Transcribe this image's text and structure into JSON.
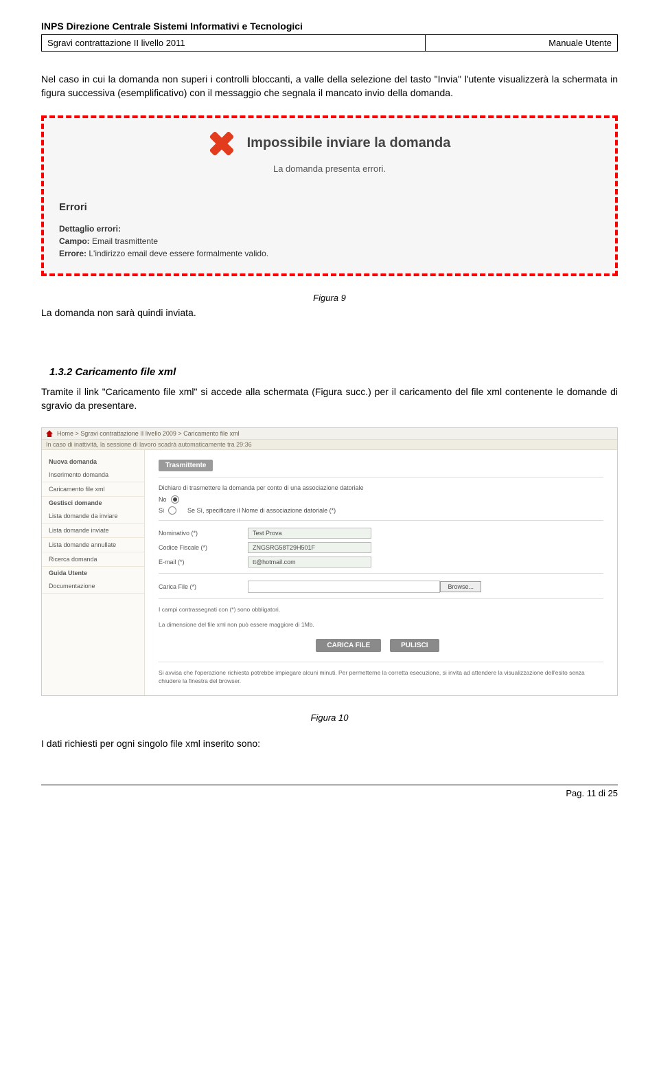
{
  "header": {
    "org": "INPS Direzione Centrale Sistemi Informativi e Tecnologici",
    "left": "Sgravi contrattazione II livello 2011",
    "right": "Manuale Utente"
  },
  "intro_para": "Nel caso in cui la domanda non superi i controlli bloccanti, a valle della selezione del tasto \"Invia\" l'utente visualizzerà la schermata in figura successiva (esemplificativo) con il messaggio che segnala il mancato invio della domanda.",
  "errbox": {
    "title": "Impossibile inviare la domanda",
    "subtitle": "La domanda presenta errori.",
    "errori_h": "Errori",
    "detail_label": "Dettaglio errori:",
    "campo_label": "Campo:",
    "campo_val": "Email trasmittente",
    "errore_label": "Errore:",
    "errore_val": "L'indirizzo email deve essere formalmente valido."
  },
  "fig9_caption": "Figura 9",
  "after_fig9": "La domanda non sarà  quindi inviata.",
  "section": {
    "num_title": "1.3.2 Caricamento file xml",
    "text": "Tramite il link \"Caricamento file xml\" si accede alla schermata (Figura succ.) per il caricamento del file xml contenente le domande di sgravio da presentare."
  },
  "shot2": {
    "breadcrumb": "Home > Sgravi contrattazione II livello 2009 > Caricamento file xml",
    "timer": "In caso di inattività, la sessione di lavoro scadrà automaticamente tra 29:36",
    "side_groups": [
      {
        "h": "Nuova domanda",
        "items": [
          "Inserimento domanda",
          "Caricamento file xml"
        ]
      },
      {
        "h": "Gestisci domande",
        "items": [
          "Lista domande da inviare",
          "Lista domande inviate",
          "Lista domande annullate",
          "Ricerca domanda"
        ]
      },
      {
        "h": "Guida Utente",
        "items": [
          "Documentazione"
        ]
      }
    ],
    "tab": "Trasmittente",
    "declare": "Dichiaro di trasmettere la domanda per conto di una associazione datoriale",
    "no": "No",
    "si": "Si",
    "si_note": "Se Sì, specificare il Nome di associazione datoriale (*)",
    "f_nominativo_l": "Nominativo (*)",
    "f_nominativo_v": "Test Prova",
    "f_cf_l": "Codice Fiscale (*)",
    "f_cf_v": "ZNGSRG58T29H501F",
    "f_email_l": "E-mail (*)",
    "f_email_v": "tt@hotmail.com",
    "f_file_l": "Carica File (*)",
    "browse": "Browse...",
    "mandatory": "I campi contrassegnati con (*) sono obbligatori.",
    "size_note": "La dimensione del file xml non può essere maggiore di 1Mb.",
    "btn_carica": "CARICA FILE",
    "btn_pulisci": "PULISCI",
    "warn": "Si avvisa che l'operazione richiesta potrebbe impiegare alcuni minuti. Per permetterne la corretta esecuzione, si invita ad attendere la visualizzazione dell'esito senza chiudere la finestra del browser."
  },
  "fig10_caption": "Figura 10",
  "after_fig10": "I dati richiesti per ogni singolo file xml inserito sono:",
  "footer": "Pag. 11 di 25"
}
